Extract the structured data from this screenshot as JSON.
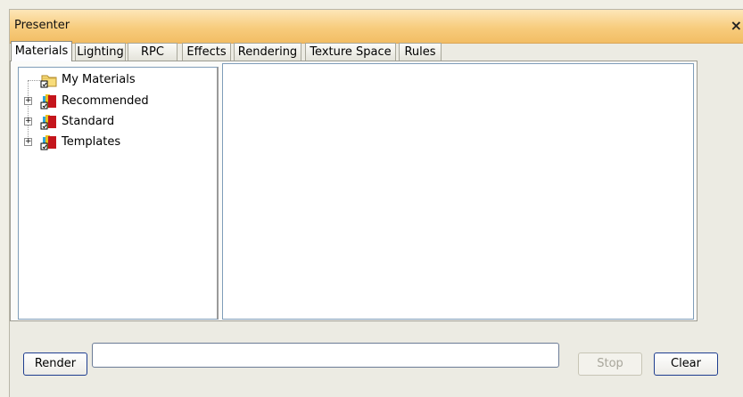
{
  "window": {
    "title": "Presenter",
    "close_glyph": "×"
  },
  "tabs": [
    {
      "label": "Materials",
      "active": true
    },
    {
      "label": "Lighting"
    },
    {
      "label": "RPC"
    },
    {
      "label": "Effects"
    },
    {
      "label": "Rendering"
    },
    {
      "label": "Texture Space"
    },
    {
      "label": "Rules"
    }
  ],
  "tree": {
    "items": [
      {
        "label": "My Materials",
        "icon": "folder-icon",
        "expandable": false
      },
      {
        "label": "Recommended",
        "icon": "material-library-icon",
        "expandable": true,
        "expander": "+"
      },
      {
        "label": "Standard",
        "icon": "material-library-icon",
        "expandable": true,
        "expander": "+"
      },
      {
        "label": "Templates",
        "icon": "material-library-icon",
        "expandable": true,
        "expander": "+"
      }
    ]
  },
  "buttons": {
    "render": "Render",
    "stop": "Stop",
    "clear": "Clear"
  },
  "progress": {
    "value": 0
  },
  "colors": {
    "titlebar": "#f7cc7d",
    "button_border": "#1e3d8f",
    "tree_border": "#7f9db9"
  }
}
